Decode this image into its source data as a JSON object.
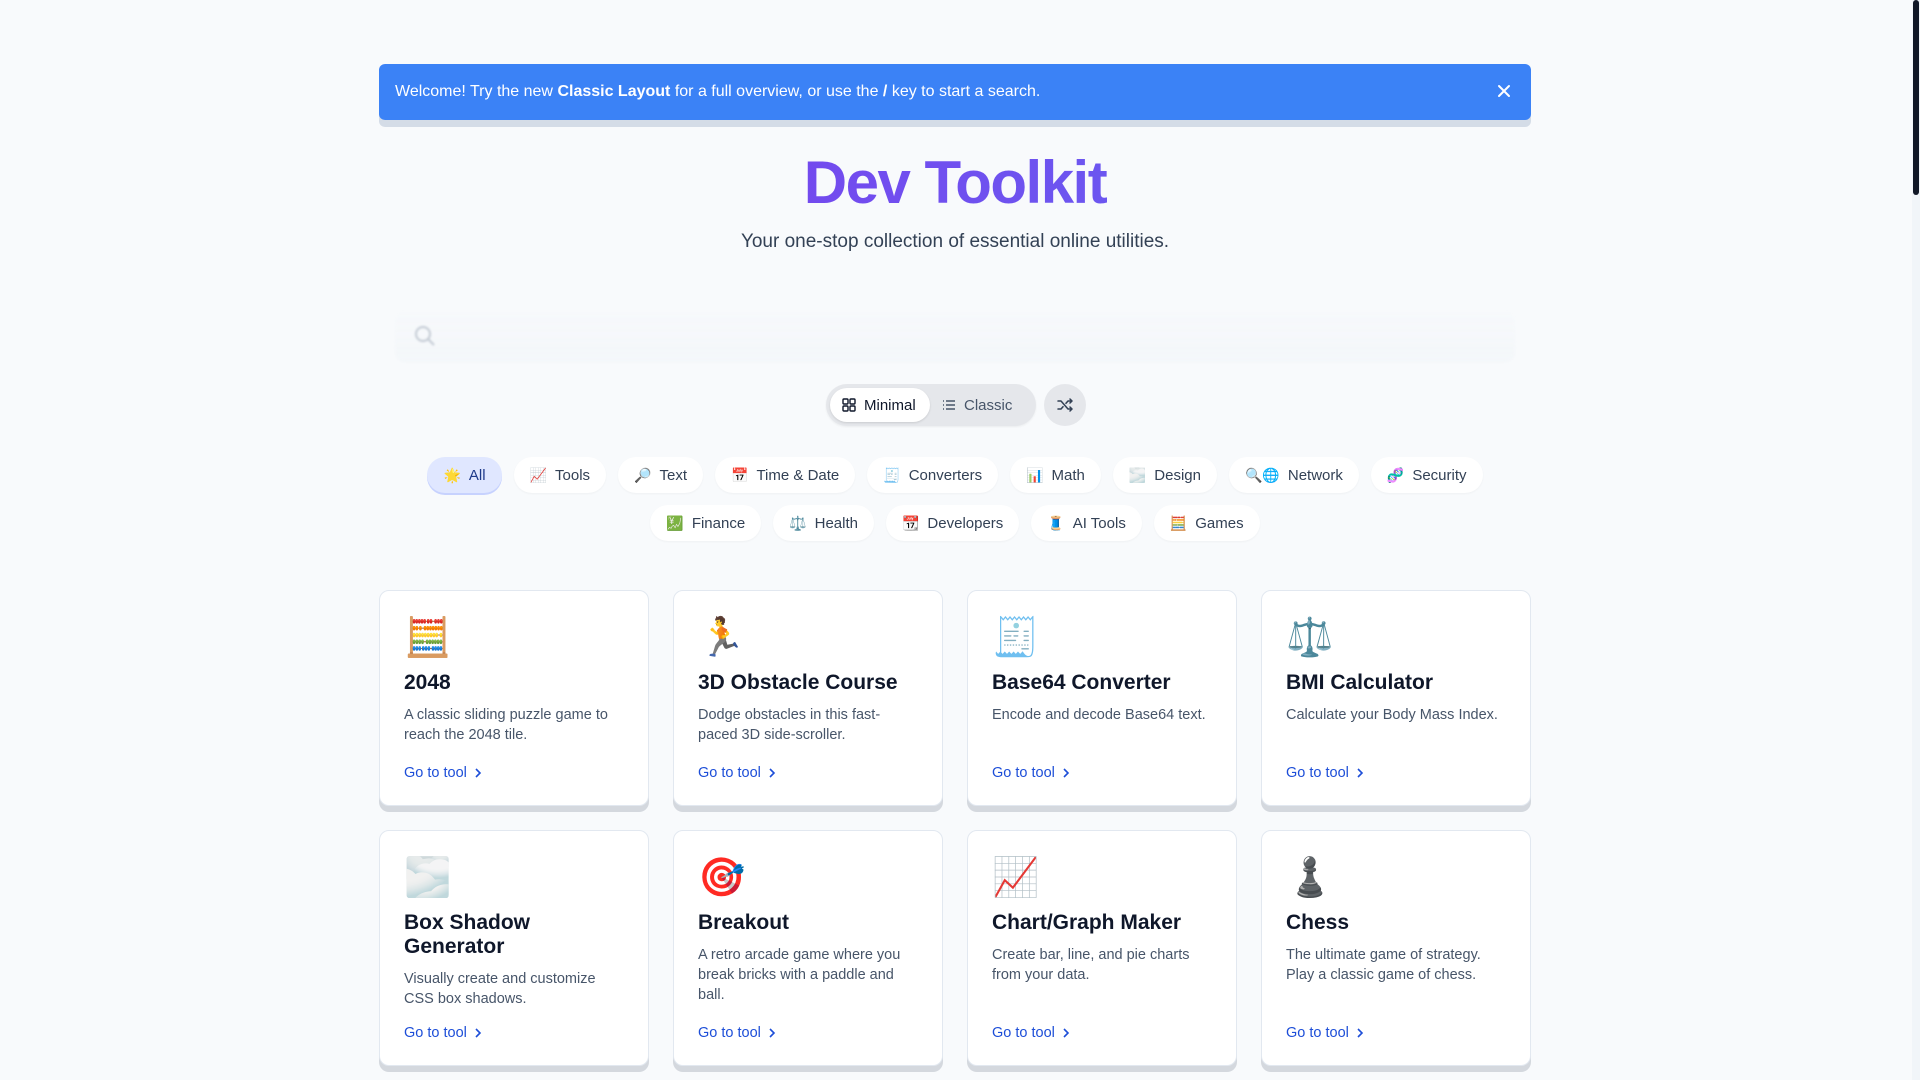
{
  "banner": {
    "text_1": "Welcome! Try the new ",
    "bold_1": "Classic Layout",
    "text_2": " for a full overview, or use the ",
    "bold_2": "/",
    "text_3": " key to start a search."
  },
  "header": {
    "title": "Dev Toolkit",
    "subtitle": "Your one-stop collection of essential online utilities."
  },
  "search": {
    "placeholder": ""
  },
  "layout_toggle": {
    "minimal": "Minimal",
    "classic": "Classic"
  },
  "categories_row1": [
    {
      "emoji": "🌟",
      "label": "All"
    },
    {
      "emoji": "📈",
      "label": "Tools"
    },
    {
      "emoji": "🔎",
      "label": "Text"
    },
    {
      "emoji": "📅",
      "label": "Time & Date"
    },
    {
      "emoji": "🧾",
      "label": "Converters"
    },
    {
      "emoji": "📊",
      "label": "Math"
    },
    {
      "emoji": "🌫️",
      "label": "Design"
    },
    {
      "emoji": "🔍🌐",
      "label": "Network"
    },
    {
      "emoji": "🧬",
      "label": "Security"
    }
  ],
  "categories_row2": [
    {
      "emoji": "💹",
      "label": "Finance"
    },
    {
      "emoji": "⚖️",
      "label": "Health"
    },
    {
      "emoji": "📆",
      "label": "Developers"
    },
    {
      "emoji": "🧵",
      "label": "AI Tools"
    },
    {
      "emoji": "🧮",
      "label": "Games"
    }
  ],
  "cards": [
    {
      "icon": "🧮",
      "name": "2048",
      "desc": "A classic sliding puzzle game to reach the 2048 tile.",
      "link": "Go to tool"
    },
    {
      "icon": "🏃",
      "name": "3D Obstacle Course",
      "desc": "Dodge obstacles in this fast-paced 3D side-scroller.",
      "link": "Go to tool"
    },
    {
      "icon": "🧾",
      "name": "Base64 Converter",
      "desc": "Encode and decode Base64 text.",
      "link": "Go to tool"
    },
    {
      "icon": "⚖️",
      "name": "BMI Calculator",
      "desc": "Calculate your Body Mass Index.",
      "link": "Go to tool"
    },
    {
      "icon": "🌫️",
      "name": "Box Shadow Generator",
      "desc": "Visually create and customize CSS box shadows.",
      "link": "Go to tool"
    },
    {
      "icon": "🎯",
      "name": "Breakout",
      "desc": "A retro arcade game where you break bricks with a paddle and ball.",
      "link": "Go to tool"
    },
    {
      "icon": "📈",
      "name": "Chart/Graph Maker",
      "desc": "Create bar, line, and pie charts from your data.",
      "link": "Go to tool"
    },
    {
      "icon": "♟️",
      "name": "Chess",
      "desc": "The ultimate game of strategy. Play a classic game of chess.",
      "link": "Go to tool"
    }
  ]
}
